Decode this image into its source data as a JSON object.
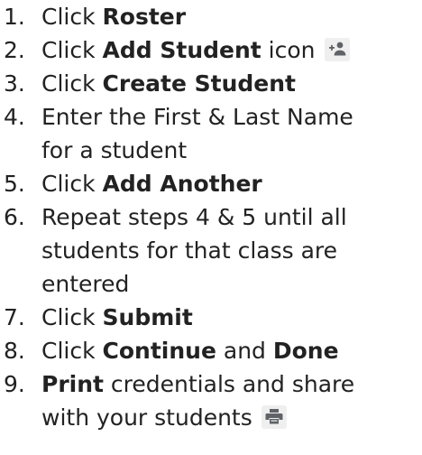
{
  "steps": [
    {
      "num": "1.",
      "pre": "Click ",
      "bold": "Roster",
      "post": ""
    },
    {
      "num": "2.",
      "pre": "Click ",
      "bold": "Add Student",
      "post": " icon",
      "icon": "add-person-icon"
    },
    {
      "num": "3.",
      "pre": "Click ",
      "bold": "Create Student",
      "post": ""
    },
    {
      "num": "4.",
      "line1": "Enter the First & Last Name",
      "line2": "for a student"
    },
    {
      "num": "5.",
      "pre": "Click ",
      "bold": "Add Another",
      "post": ""
    },
    {
      "num": "6.",
      "line1": "Repeat steps 4 & 5 until all",
      "line2": "students for that class are",
      "line3": "entered"
    },
    {
      "num": "7.",
      "pre": "Click ",
      "bold": "Submit",
      "post": ""
    },
    {
      "num": "8.",
      "pre": "Click ",
      "bold": "Continue",
      "mid": " and ",
      "bold2": "Done"
    },
    {
      "num": "9.",
      "bold": "Print",
      "post": " credentials and share",
      "line2": "with your students",
      "icon": "print-icon"
    }
  ],
  "colors": {
    "text": "#222222",
    "icon": "#5f6368",
    "icon_bg": "#efefef"
  }
}
